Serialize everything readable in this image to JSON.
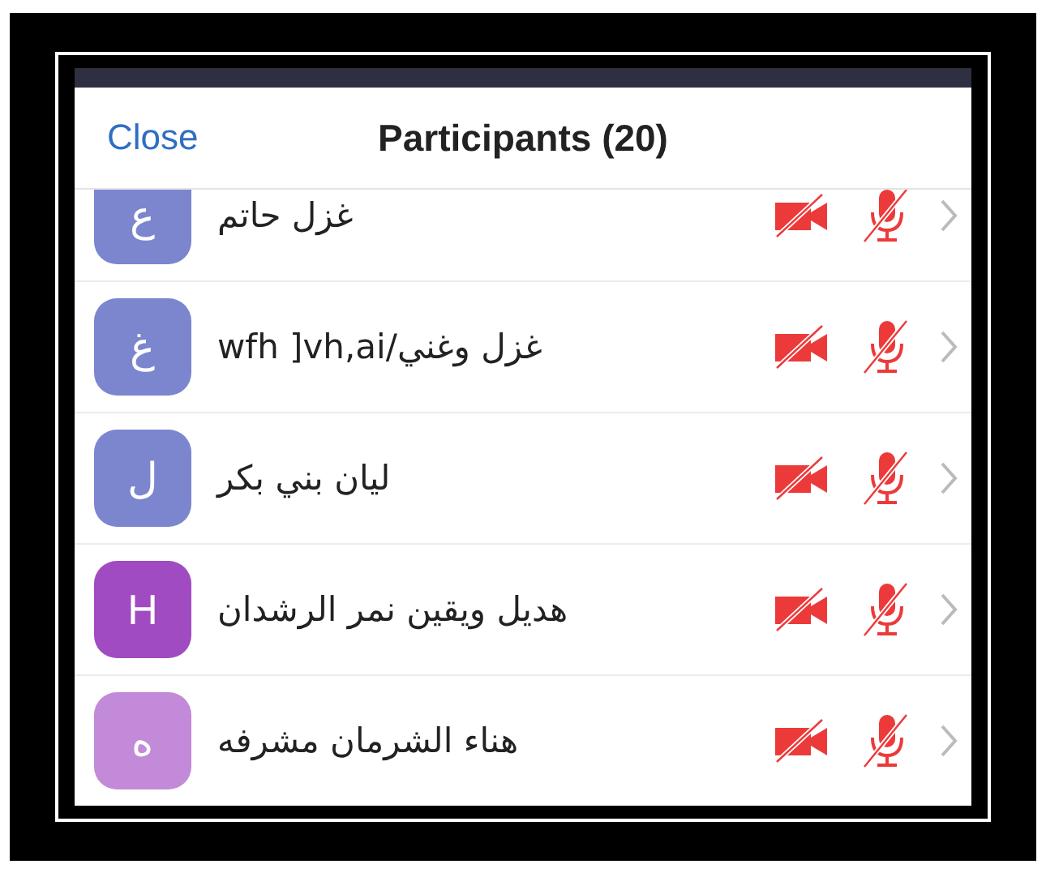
{
  "header": {
    "close": "Close",
    "title": "Participants (20)"
  },
  "participants": [
    {
      "initial": "ع",
      "name": "غزل حاتم",
      "color": "#7b86cf",
      "video_off": true,
      "muted": true
    },
    {
      "initial": "غ",
      "name": "wfh ]vh,ai/غزل وغني",
      "color": "#7b86cf",
      "video_off": true,
      "muted": true
    },
    {
      "initial": "ل",
      "name": "ليان بني بكر",
      "color": "#7b86cf",
      "video_off": true,
      "muted": true
    },
    {
      "initial": "H",
      "name": "هديل ويقين  نمر الرشدان",
      "color": "#a14bc2",
      "video_off": true,
      "muted": true
    },
    {
      "initial": "ه",
      "name": "هناء الشرمان مشرفه",
      "color": "#c28ad8",
      "video_off": true,
      "muted": true
    }
  ]
}
